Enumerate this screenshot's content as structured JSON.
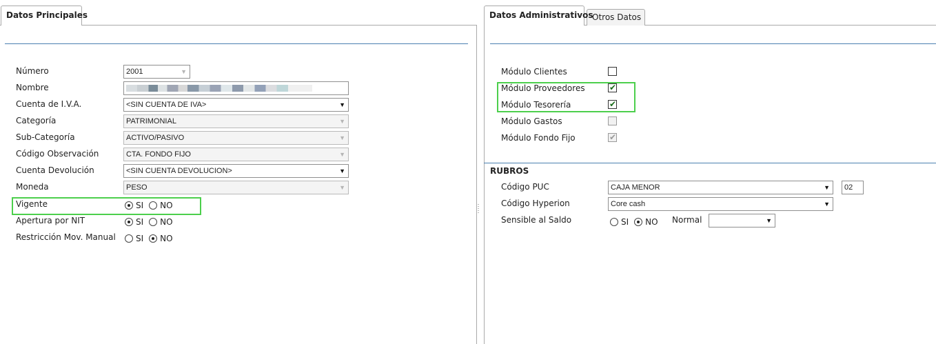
{
  "left": {
    "tab": "Datos Principales",
    "fields": {
      "numero": {
        "label": "Número",
        "value": "2001"
      },
      "nombre": {
        "label": "Nombre",
        "value": ""
      },
      "cuenta_iva": {
        "label": "Cuenta de I.V.A.",
        "value": "<SIN CUENTA DE IVA>"
      },
      "categoria": {
        "label": "Categoría",
        "value": "PATRIMONIAL"
      },
      "subcategoria": {
        "label": "Sub-Categoría",
        "value": "ACTIVO/PASIVO"
      },
      "codigo_obs": {
        "label": "Código Observación",
        "value": "CTA. FONDO FIJO"
      },
      "cuenta_dev": {
        "label": "Cuenta Devolución",
        "value": "<SIN CUENTA DEVOLUCION>"
      },
      "moneda": {
        "label": "Moneda",
        "value": "PESO"
      }
    },
    "radios": {
      "vigente": {
        "label": "Vigente",
        "si": "SI",
        "no": "NO",
        "selected": "SI"
      },
      "apertura_nit": {
        "label": "Apertura por NIT",
        "si": "SI",
        "no": "NO",
        "selected": "SI"
      },
      "restriccion": {
        "label": "Restricción Mov. Manual",
        "si": "SI",
        "no": "NO",
        "selected": "NO"
      }
    }
  },
  "right": {
    "tabs": {
      "active": "Datos Administrativos",
      "inactive": "Otros Datos"
    },
    "modules": [
      {
        "label": "Módulo Clientes",
        "checked": false,
        "enabled": true
      },
      {
        "label": "Módulo Proveedores",
        "checked": true,
        "enabled": true
      },
      {
        "label": "Módulo Tesorería",
        "checked": true,
        "enabled": true
      },
      {
        "label": "Módulo Gastos",
        "checked": false,
        "enabled": false
      },
      {
        "label": "Módulo Fondo Fijo",
        "checked": true,
        "enabled": false
      }
    ],
    "rubros": {
      "title": "RUBROS",
      "codigo_puc": {
        "label": "Código PUC",
        "value": "CAJA  MENOR",
        "code": "02"
      },
      "codigo_hyperion": {
        "label": "Código Hyperion",
        "value": "Core cash"
      },
      "sensible": {
        "label": "Sensible al Saldo",
        "si": "SI",
        "no": "NO",
        "selected": "NO",
        "normal_label": "Normal",
        "normal_value": ""
      }
    }
  },
  "colors": {
    "highlight": "#4ccf4c",
    "divider": "#4a7fb0",
    "border": "#a9a9a9"
  },
  "icons": {
    "dropdown": "chevron-down-icon",
    "check": "checkmark-icon"
  }
}
